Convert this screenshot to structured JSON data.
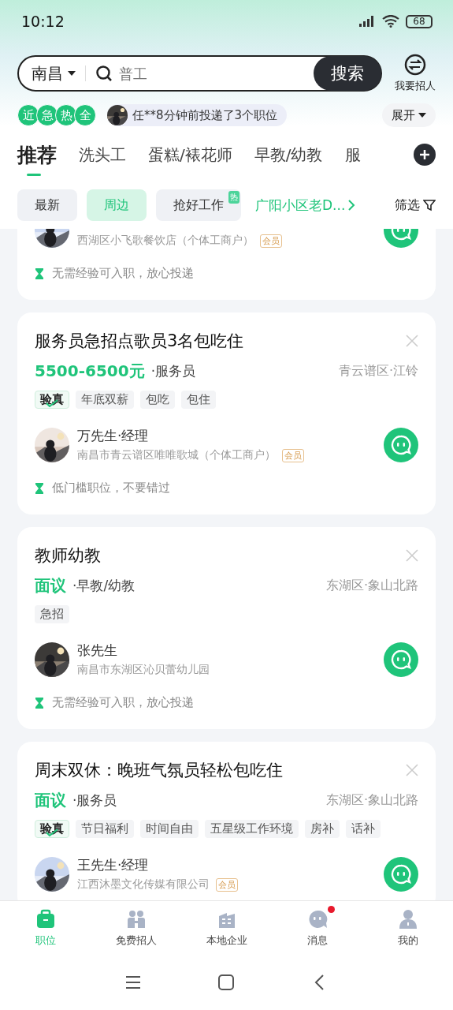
{
  "status_bar": {
    "time": "10:12",
    "battery": "68"
  },
  "search": {
    "city": "南昌",
    "placeholder": "普工",
    "button": "搜索"
  },
  "post_job": {
    "label": "我要招人"
  },
  "ticker": {
    "badges": [
      "近",
      "急",
      "热",
      "全"
    ],
    "message": "任**8分钟前投递了3个职位",
    "expand": "展开"
  },
  "tabs": [
    {
      "label": "推荐",
      "selected": true
    },
    {
      "label": "洗头工",
      "selected": false
    },
    {
      "label": "蛋糕/裱花师",
      "selected": false
    },
    {
      "label": "早教/幼教",
      "selected": false
    },
    {
      "label": "服",
      "selected": false
    }
  ],
  "filters": [
    {
      "kind": "chip",
      "label": "最新",
      "selected": false
    },
    {
      "kind": "chip",
      "label": "周边",
      "selected": true
    },
    {
      "kind": "chip",
      "label": "抢好工作",
      "selected": false,
      "badge": "热"
    },
    {
      "kind": "link",
      "label": "广阳小区老D..."
    },
    {
      "kind": "filter",
      "label": "筛选"
    }
  ],
  "jobs": [
    {
      "company": "西湖区小飞歌餐饮店（个体工商户）",
      "member": "会员",
      "hint": "无需经验可入职，放心投递"
    },
    {
      "title": "服务员急招点歌员3名包吃住",
      "salary": "5500-6500元",
      "category": "·服务员",
      "location": "青云谱区·江铃",
      "tags": [
        {
          "kind": "verified",
          "label": "验真"
        },
        {
          "kind": "plain",
          "label": "年底双薪"
        },
        {
          "kind": "plain",
          "label": "包吃"
        },
        {
          "kind": "plain",
          "label": "包住"
        }
      ],
      "contact": "万先生·经理",
      "company": "南昌市青云谱区唯唯歌城（个体工商户）",
      "member": "会员",
      "hint": "低门槛职位，不要错过"
    },
    {
      "title": "教师幼教",
      "salary": "面议",
      "category": "·早教/幼教",
      "location": "东湖区·象山北路",
      "tags": [
        {
          "kind": "plain",
          "label": "急招"
        }
      ],
      "contact": "张先生",
      "company": "南昌市东湖区沁贝蕾幼儿园",
      "hint": "无需经验可入职，放心投递"
    },
    {
      "title": "周末双休：晚班气氛员轻松包吃住",
      "salary": "面议",
      "category": "·服务员",
      "location": "东湖区·象山北路",
      "tags": [
        {
          "kind": "verified",
          "label": "验真"
        },
        {
          "kind": "plain",
          "label": "节日福利"
        },
        {
          "kind": "plain",
          "label": "时间自由"
        },
        {
          "kind": "plain",
          "label": "五星级工作环境"
        },
        {
          "kind": "plain",
          "label": "房补"
        },
        {
          "kind": "plain",
          "label": "话补"
        }
      ],
      "contact": "王先生·经理",
      "company": "江西沐墨文化传媒有限公司",
      "member": "会员"
    }
  ],
  "nav": [
    {
      "label": "职位",
      "selected": true,
      "badge": false
    },
    {
      "label": "免费招人",
      "selected": false,
      "badge": false
    },
    {
      "label": "本地企业",
      "selected": false,
      "badge": false
    },
    {
      "label": "消息",
      "selected": false,
      "badge": true
    },
    {
      "label": "我的",
      "selected": false,
      "badge": false
    }
  ]
}
